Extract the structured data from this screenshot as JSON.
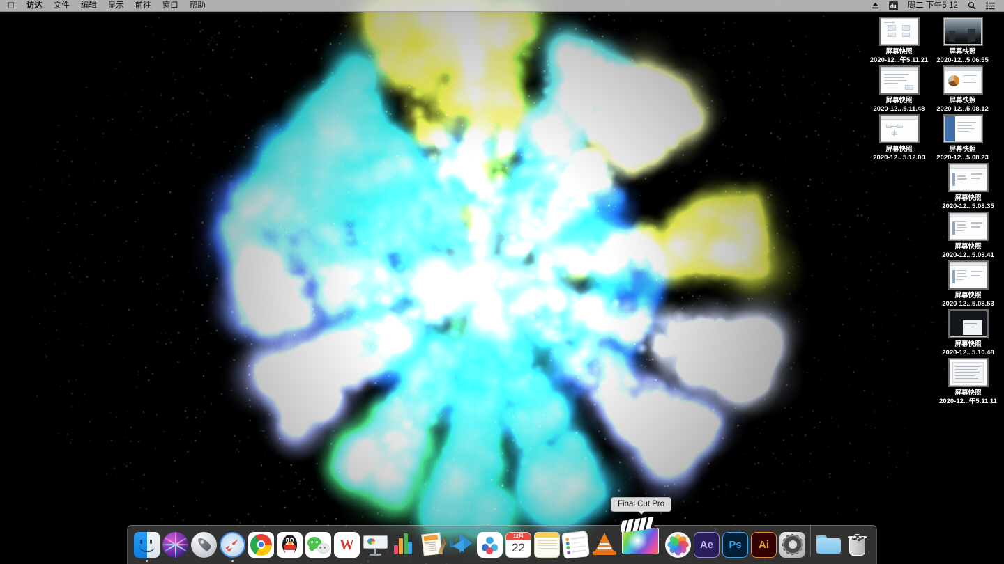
{
  "menubar": {
    "apple_icon": "apple-logo-icon",
    "items": [
      {
        "label": "访达",
        "bold": true
      },
      {
        "label": "文件",
        "bold": false
      },
      {
        "label": "编辑",
        "bold": false
      },
      {
        "label": "显示",
        "bold": false
      },
      {
        "label": "前往",
        "bold": false
      },
      {
        "label": "窗口",
        "bold": false
      },
      {
        "label": "帮助",
        "bold": false
      }
    ],
    "status": {
      "eject_icon": "eject-icon",
      "du_label": "du",
      "clock": "周二 下午5:12",
      "search_icon": "search-icon",
      "control_center_icon": "control-center-icon"
    }
  },
  "desktop": {
    "icons": [
      {
        "name": "屏幕快照",
        "detail": "2020-12...午5.11.21",
        "thumb": "doc-boxes"
      },
      {
        "name": "屏幕快照",
        "detail": "2020-12...5.06.55",
        "thumb": "photo"
      },
      {
        "name": "屏幕快照",
        "detail": "2020-12...5.11.48",
        "thumb": "text-window"
      },
      {
        "name": "屏幕快照",
        "detail": "2020-12...5.08.12",
        "thumb": "chart-doc"
      },
      {
        "name": "屏幕快照",
        "detail": "2020-12...5.12.00",
        "thumb": "diagram"
      },
      {
        "name": "屏幕快照",
        "detail": "2020-12...5.08.23",
        "thumb": "sidebar-window"
      },
      {
        "name": "屏幕快照",
        "detail": "2020-12...5.08.35",
        "thumb": "tree-window"
      },
      {
        "name": "屏幕快照",
        "detail": "2020-12...5.08.41",
        "thumb": "tree-window"
      },
      {
        "name": "屏幕快照",
        "detail": "2020-12...5.08.53",
        "thumb": "tree-window"
      },
      {
        "name": "屏幕快照",
        "detail": "2020-12...5.10.48",
        "thumb": "dark-screen"
      },
      {
        "name": "屏幕快照",
        "detail": "2020-12...午5.11.11",
        "thumb": "ime-panel"
      }
    ]
  },
  "dock": {
    "tooltip": "Final Cut Pro",
    "calendar": {
      "month": "12月",
      "day": "22"
    },
    "wps_letter": "W",
    "after_effects_label": "Ae",
    "photoshop_label": "Ps",
    "illustrator_label": "Ai",
    "items": [
      {
        "label": "访达",
        "icon": "finder-icon",
        "running": true,
        "magnified": false
      },
      {
        "label": "Siri",
        "icon": "siri-icon",
        "running": false,
        "magnified": false
      },
      {
        "label": "启动台",
        "icon": "launchpad-icon",
        "running": false,
        "magnified": false
      },
      {
        "label": "Safari 浏览器",
        "icon": "safari-icon",
        "running": true,
        "magnified": false
      },
      {
        "label": "Google Chrome",
        "icon": "chrome-icon",
        "running": false,
        "magnified": false
      },
      {
        "label": "QQ",
        "icon": "qq-icon",
        "running": false,
        "magnified": false
      },
      {
        "label": "微信",
        "icon": "wechat-icon",
        "running": false,
        "magnified": false
      },
      {
        "label": "WPS Office",
        "icon": "wps-icon",
        "running": false,
        "magnified": false
      },
      {
        "label": "Keynote 讲演",
        "icon": "keynote-icon",
        "running": false,
        "magnified": false
      },
      {
        "label": "Numbers 表格",
        "icon": "numbers-icon",
        "running": false,
        "magnified": false
      },
      {
        "label": "Pages 文稿",
        "icon": "pages-icon",
        "running": false,
        "magnified": false
      },
      {
        "label": "Visual Studio Code",
        "icon": "vscode-icon",
        "running": false,
        "magnified": false
      },
      {
        "label": "应用程序",
        "icon": "blue-circles-app-icon",
        "running": false,
        "magnified": false
      },
      {
        "label": "日历",
        "icon": "calendar-icon",
        "running": false,
        "magnified": false
      },
      {
        "label": "备忘录",
        "icon": "notes-icon",
        "running": false,
        "magnified": false
      },
      {
        "label": "提醒事项",
        "icon": "reminders-icon",
        "running": false,
        "magnified": false
      },
      {
        "label": "VLC",
        "icon": "vlc-icon",
        "running": false,
        "magnified": false
      },
      {
        "label": "Final Cut Pro",
        "icon": "final-cut-pro-icon",
        "running": false,
        "magnified": true
      },
      {
        "label": "照片",
        "icon": "photos-icon",
        "running": false,
        "magnified": false
      },
      {
        "label": "After Effects",
        "icon": "after-effects-icon",
        "running": false,
        "magnified": false
      },
      {
        "label": "Photoshop",
        "icon": "photoshop-icon",
        "running": false,
        "magnified": false
      },
      {
        "label": "Illustrator",
        "icon": "illustrator-icon",
        "running": false,
        "magnified": false
      },
      {
        "label": "系统偏好设置",
        "icon": "system-preferences-icon",
        "running": false,
        "magnified": false
      },
      {
        "label": "下载",
        "icon": "downloads-folder-icon",
        "running": false,
        "magnified": false
      },
      {
        "label": "废纸篓",
        "icon": "trash-icon",
        "running": false,
        "magnified": false
      }
    ]
  },
  "wallpaper": {
    "description": "colour-powder-explosion",
    "background_color": "#000000",
    "palette": [
      "#1b3fe0",
      "#2aa8f2",
      "#35e0e8",
      "#49e08a",
      "#c8e34a",
      "#8a7fe8",
      "#d8d8d8"
    ]
  }
}
